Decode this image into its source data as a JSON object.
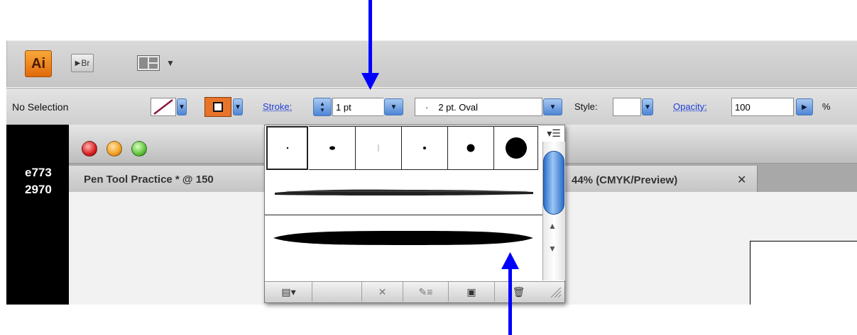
{
  "app": {
    "logo_text": "Ai",
    "bridge_label": "Br"
  },
  "control_bar": {
    "selection_status": "No Selection",
    "stroke_label": "Stroke:",
    "stroke_value": "1 pt",
    "brush_value": "2 pt. Oval",
    "brush_bullet": "·",
    "style_label": "Style:",
    "opacity_label": "Opacity:",
    "opacity_value": "100",
    "opacity_unit": "%"
  },
  "document": {
    "sidebar_text_1": "e773",
    "sidebar_text_2": "2970",
    "tab_title_left": "Pen Tool Practice * @ 150",
    "tab_title_right": "44% (CMYK/Preview)",
    "tab_close": "✕"
  },
  "brush_panel": {
    "calligraphic_brushes": [
      "dot-tiny",
      "oval-flat",
      "line-thin",
      "dot-small",
      "dot-medium",
      "dot-large"
    ],
    "art_brushes": [
      "charcoal-stroke",
      "tapered-oval-stroke"
    ],
    "panel_menu_icon": "panel-menu-icon",
    "bottom_buttons": [
      "brush-libraries-icon",
      "remove-stroke-icon",
      "brush-options-icon",
      "new-brush-icon",
      "delete-brush-icon"
    ]
  },
  "colors": {
    "stroke_swatch": "#8b1a3a",
    "fill_swatch": "#e8742a",
    "annotation_arrow": "#0000ff",
    "link_blue": "#1f3fd6"
  }
}
